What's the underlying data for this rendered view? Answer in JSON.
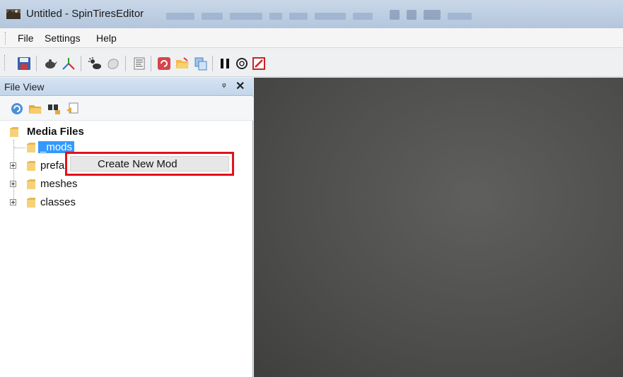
{
  "window": {
    "title": "Untitled - SpinTiresEditor"
  },
  "menubar": {
    "items": [
      "File",
      "Settings",
      "Help"
    ]
  },
  "toolbar": {
    "icons": [
      "save-icon",
      "teapot-icon",
      "axis-icon",
      "weather-icon",
      "material-icon",
      "list-icon",
      "refresh-red-icon",
      "open-folder-icon",
      "copy-icon",
      "pause-icon",
      "zoom-icon",
      "stop-red-icon"
    ]
  },
  "file_view": {
    "title": "File View",
    "pin_glyph": "ᵠ",
    "close_glyph": "✕",
    "tools": [
      "refresh-icon",
      "open-folder-icon",
      "search-files-icon",
      "export-icon"
    ],
    "tree": {
      "root": "Media Files",
      "children": [
        {
          "label": "_mods",
          "selected": true,
          "expandable": false
        },
        {
          "label": "prefabs",
          "selected": false,
          "expandable": true
        },
        {
          "label": "meshes",
          "selected": false,
          "expandable": true
        },
        {
          "label": "classes",
          "selected": false,
          "expandable": true
        }
      ]
    }
  },
  "context_menu": {
    "items": [
      "Create New Mod"
    ],
    "highlight_color": "#e3121a"
  },
  "colors": {
    "selection": "#3399ff",
    "viewport": "#4d4d4b"
  }
}
